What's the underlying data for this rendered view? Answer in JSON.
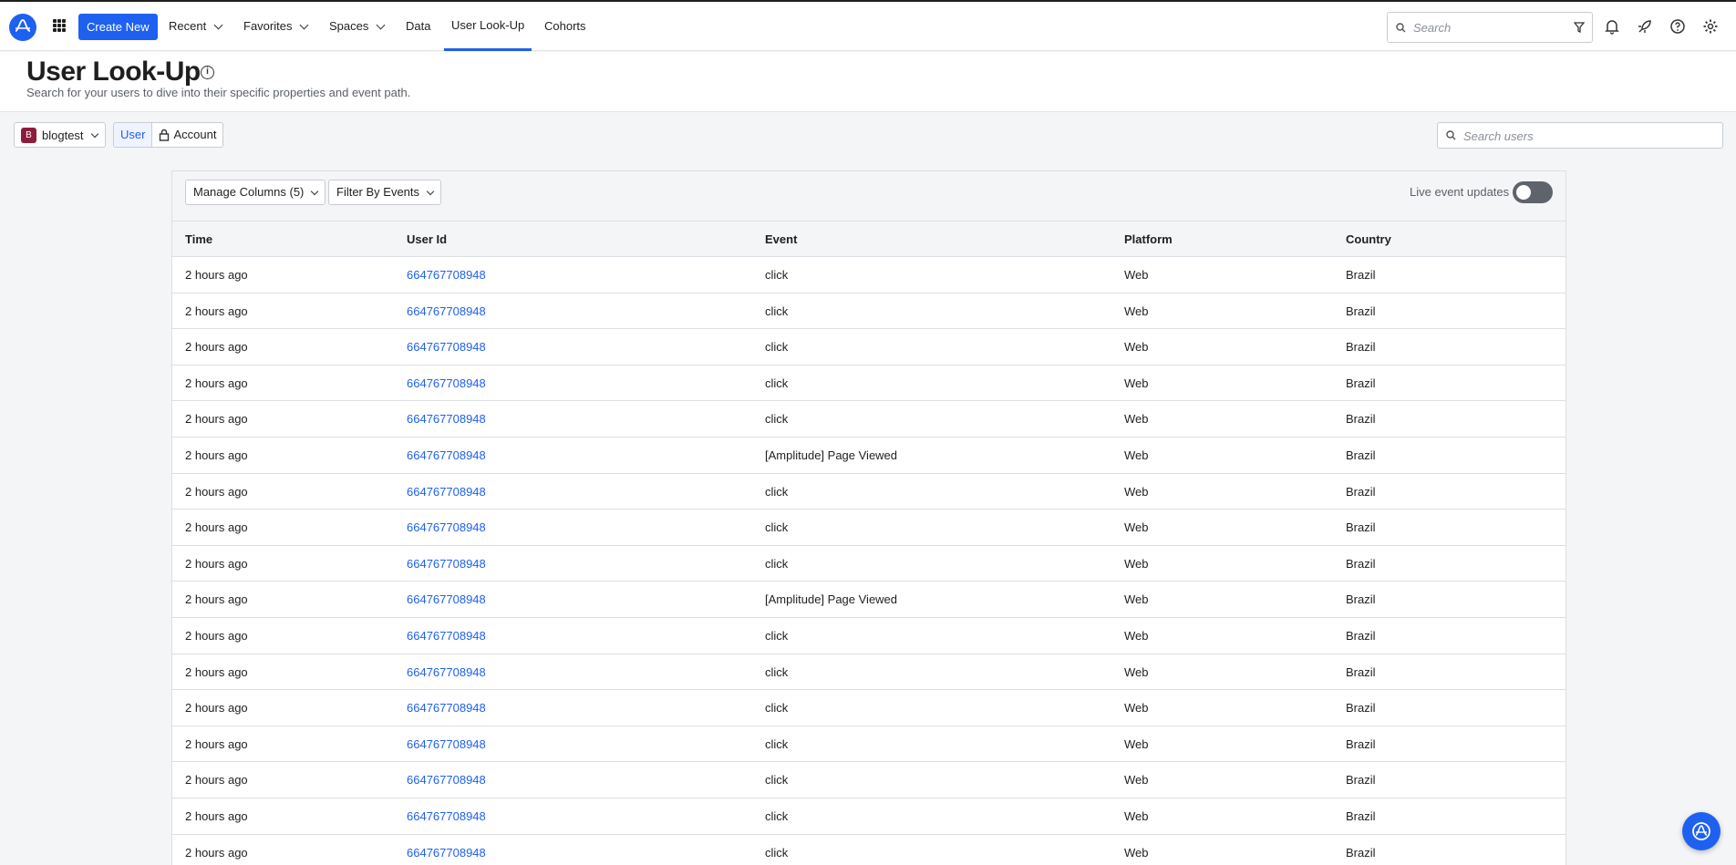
{
  "nav": {
    "create_new": "Create New",
    "items": [
      {
        "label": "Recent"
      },
      {
        "label": "Favorites"
      },
      {
        "label": "Spaces"
      },
      {
        "label": "Data"
      },
      {
        "label": "User Look-Up"
      },
      {
        "label": "Cohorts"
      }
    ],
    "active": "User Look-Up",
    "search_placeholder": "Search"
  },
  "header": {
    "title": "User Look-Up",
    "subtitle": "Search for your users to dive into their specific properties and event path."
  },
  "controls": {
    "project_badge": "B",
    "project_name": "blogtest",
    "segments": [
      "User",
      "Account"
    ],
    "active_segment": "User",
    "search_users_placeholder": "Search users"
  },
  "toolbar": {
    "manage_columns": "Manage Columns (5)",
    "filter_by_events": "Filter By Events",
    "live_label": "Live event updates",
    "live_enabled": false
  },
  "table": {
    "columns": [
      "Time",
      "User Id",
      "Event",
      "Platform",
      "Country"
    ],
    "rows": [
      [
        "2 hours ago",
        "664767708948",
        "click",
        "Web",
        "Brazil"
      ],
      [
        "2 hours ago",
        "664767708948",
        "click",
        "Web",
        "Brazil"
      ],
      [
        "2 hours ago",
        "664767708948",
        "click",
        "Web",
        "Brazil"
      ],
      [
        "2 hours ago",
        "664767708948",
        "click",
        "Web",
        "Brazil"
      ],
      [
        "2 hours ago",
        "664767708948",
        "click",
        "Web",
        "Brazil"
      ],
      [
        "2 hours ago",
        "664767708948",
        "[Amplitude] Page Viewed",
        "Web",
        "Brazil"
      ],
      [
        "2 hours ago",
        "664767708948",
        "click",
        "Web",
        "Brazil"
      ],
      [
        "2 hours ago",
        "664767708948",
        "click",
        "Web",
        "Brazil"
      ],
      [
        "2 hours ago",
        "664767708948",
        "click",
        "Web",
        "Brazil"
      ],
      [
        "2 hours ago",
        "664767708948",
        "[Amplitude] Page Viewed",
        "Web",
        "Brazil"
      ],
      [
        "2 hours ago",
        "664767708948",
        "click",
        "Web",
        "Brazil"
      ],
      [
        "2 hours ago",
        "664767708948",
        "click",
        "Web",
        "Brazil"
      ],
      [
        "2 hours ago",
        "664767708948",
        "click",
        "Web",
        "Brazil"
      ],
      [
        "2 hours ago",
        "664767708948",
        "click",
        "Web",
        "Brazil"
      ],
      [
        "2 hours ago",
        "664767708948",
        "click",
        "Web",
        "Brazil"
      ],
      [
        "2 hours ago",
        "664767708948",
        "click",
        "Web",
        "Brazil"
      ],
      [
        "2 hours ago",
        "664767708948",
        "click",
        "Web",
        "Brazil"
      ]
    ]
  },
  "colors": {
    "accent": "#1e61f0",
    "project_badge": "#8c1d3e"
  }
}
